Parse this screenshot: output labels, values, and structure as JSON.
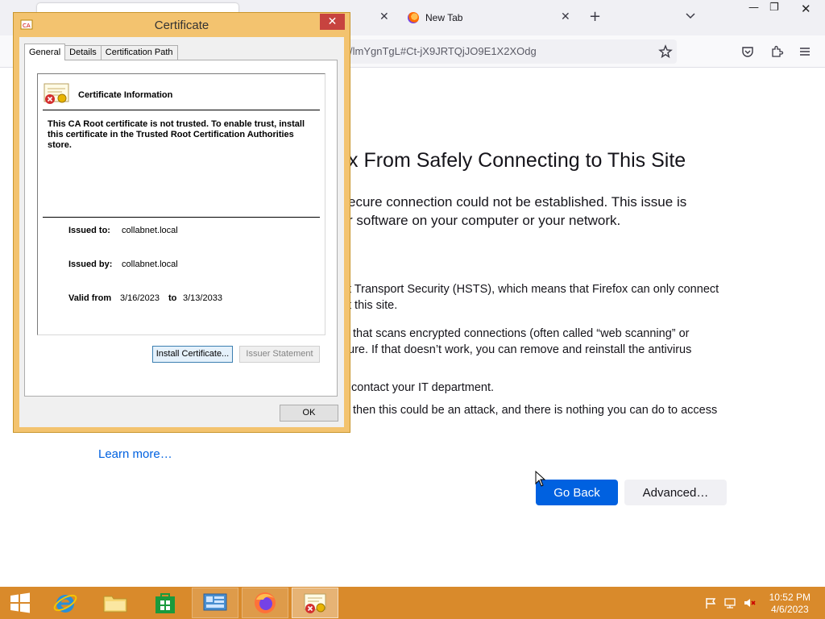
{
  "browser": {
    "tabs": [
      {
        "label": "",
        "active": true
      },
      {
        "label": "New Tab",
        "active": false
      }
    ],
    "url_visible": "/lmYgnTgL#Ct-jX9JRTQjJO9E1X2XOdg",
    "window_controls": {
      "minimize": "—",
      "restore": "❐",
      "close": "✕"
    }
  },
  "error_page": {
    "title_visible": "x From Safely Connecting to This Site",
    "intro_line1": "ecure connection could not be established. This issue is",
    "intro_line2": "r software on your computer or your network.",
    "item1_line1": "t Transport Security (HSTS), which means that Firefox can only connect",
    "item1_line2": "t this site.",
    "item2_line1": "that scans encrypted connections (often called “web scanning” or",
    "item2_line2": "ure. If that doesn’t work, you can remove and reinstall the antivirus",
    "item3": "contact your IT department.",
    "item4": "then this could be an attack, and there is nothing you can do to access",
    "learn_more": "Learn more…",
    "go_back": "Go Back",
    "advanced": "Advanced…"
  },
  "certificate_dialog": {
    "title": "Certificate",
    "close": "✕",
    "tabs": [
      "General",
      "Details",
      "Certification Path"
    ],
    "selected_tab": "General",
    "heading": "Certificate Information",
    "warning": "This CA Root certificate is not trusted. To enable trust, install this certificate in the Trusted Root Certification Authorities store.",
    "issued_to_label": "Issued to:",
    "issued_to": "collabnet.local",
    "issued_by_label": "Issued by:",
    "issued_by": "collabnet.local",
    "valid_from_label": "Valid from",
    "valid_from": "3/16/2023",
    "to_label": "to",
    "valid_to": "3/13/2033",
    "install_button": "Install Certificate...",
    "issuer_statement_button": "Issuer Statement",
    "ok_button": "OK"
  },
  "taskbar": {
    "items": [
      "start",
      "internet-explorer",
      "file-explorer",
      "store",
      "control-panel",
      "firefox",
      "certificate"
    ],
    "active_item": "certificate",
    "clock_time": "10:52 PM",
    "clock_date": "4/6/2023"
  },
  "colors": {
    "taskbar": "#d98a2b",
    "dialog_frame": "#f3c36f",
    "primary_button": "#0061e0",
    "close_button": "#c7433f"
  }
}
